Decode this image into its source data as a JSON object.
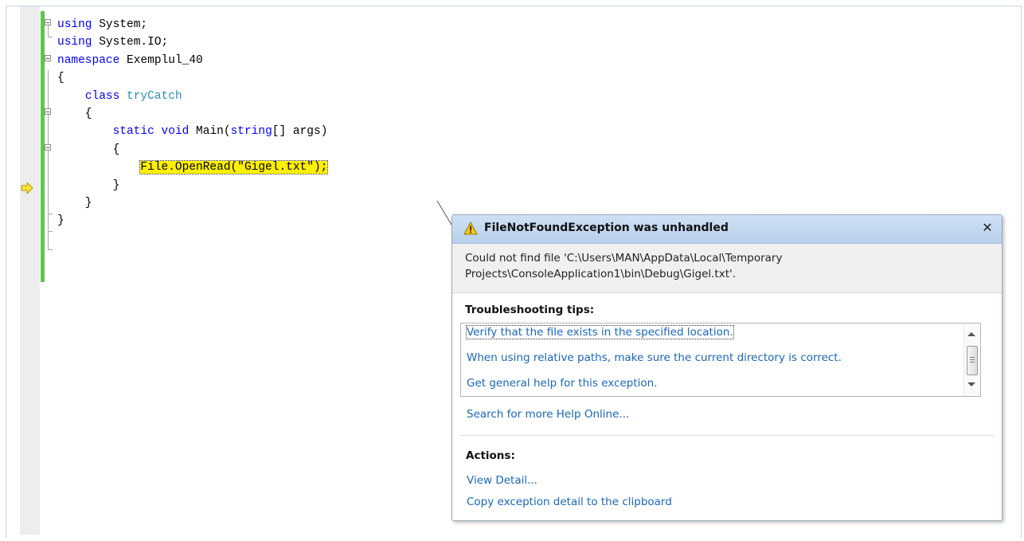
{
  "editor": {
    "lines": [
      [
        {
          "t": "using",
          "c": "kw"
        },
        {
          "t": " System;",
          "c": ""
        }
      ],
      [
        {
          "t": "using",
          "c": "kw"
        },
        {
          "t": " System.IO;",
          "c": ""
        }
      ],
      [
        {
          "t": "namespace",
          "c": "kw"
        },
        {
          "t": " Exemplul_40",
          "c": ""
        }
      ],
      [
        {
          "t": "{",
          "c": ""
        }
      ],
      [
        {
          "t": "    ",
          "c": ""
        },
        {
          "t": "class",
          "c": "kw"
        },
        {
          "t": " ",
          "c": ""
        },
        {
          "t": "tryCatch",
          "c": "type"
        }
      ],
      [
        {
          "t": "    {",
          "c": ""
        }
      ],
      [
        {
          "t": "        ",
          "c": ""
        },
        {
          "t": "static",
          "c": "kw"
        },
        {
          "t": " ",
          "c": ""
        },
        {
          "t": "void",
          "c": "kw"
        },
        {
          "t": " Main(",
          "c": ""
        },
        {
          "t": "string",
          "c": "kw"
        },
        {
          "t": "[] args)",
          "c": ""
        }
      ],
      [
        {
          "t": "        {",
          "c": ""
        }
      ],
      [
        {
          "t": "            ",
          "c": ""
        },
        {
          "t": "File.OpenRead(\"Gigel.txt\");",
          "c": "hl"
        }
      ],
      [
        {
          "t": "        }",
          "c": ""
        }
      ],
      [
        {
          "t": "    }",
          "c": ""
        }
      ],
      [
        {
          "t": "}",
          "c": ""
        }
      ]
    ],
    "current_statement_icon": "yellow-arrow-icon"
  },
  "exception_popup": {
    "warning_icon": "warning-triangle-icon",
    "title": "FileNotFoundException was unhandled",
    "close_label": "✕",
    "message_line1": "Could not find file 'C:\\Users\\MAN\\AppData\\Local\\Temporary",
    "message_line2": "Projects\\ConsoleApplication1\\bin\\Debug\\Gigel.txt'.",
    "troubleshooting_label": "Troubleshooting tips:",
    "tips": [
      "Verify that the file exists in the specified location.",
      "When using relative paths, make sure the current directory is correct.",
      "Get general help for this exception."
    ],
    "search_link": "Search for more Help Online...",
    "actions_label": "Actions:",
    "actions": [
      "View Detail...",
      "Copy exception detail to the clipboard"
    ]
  }
}
